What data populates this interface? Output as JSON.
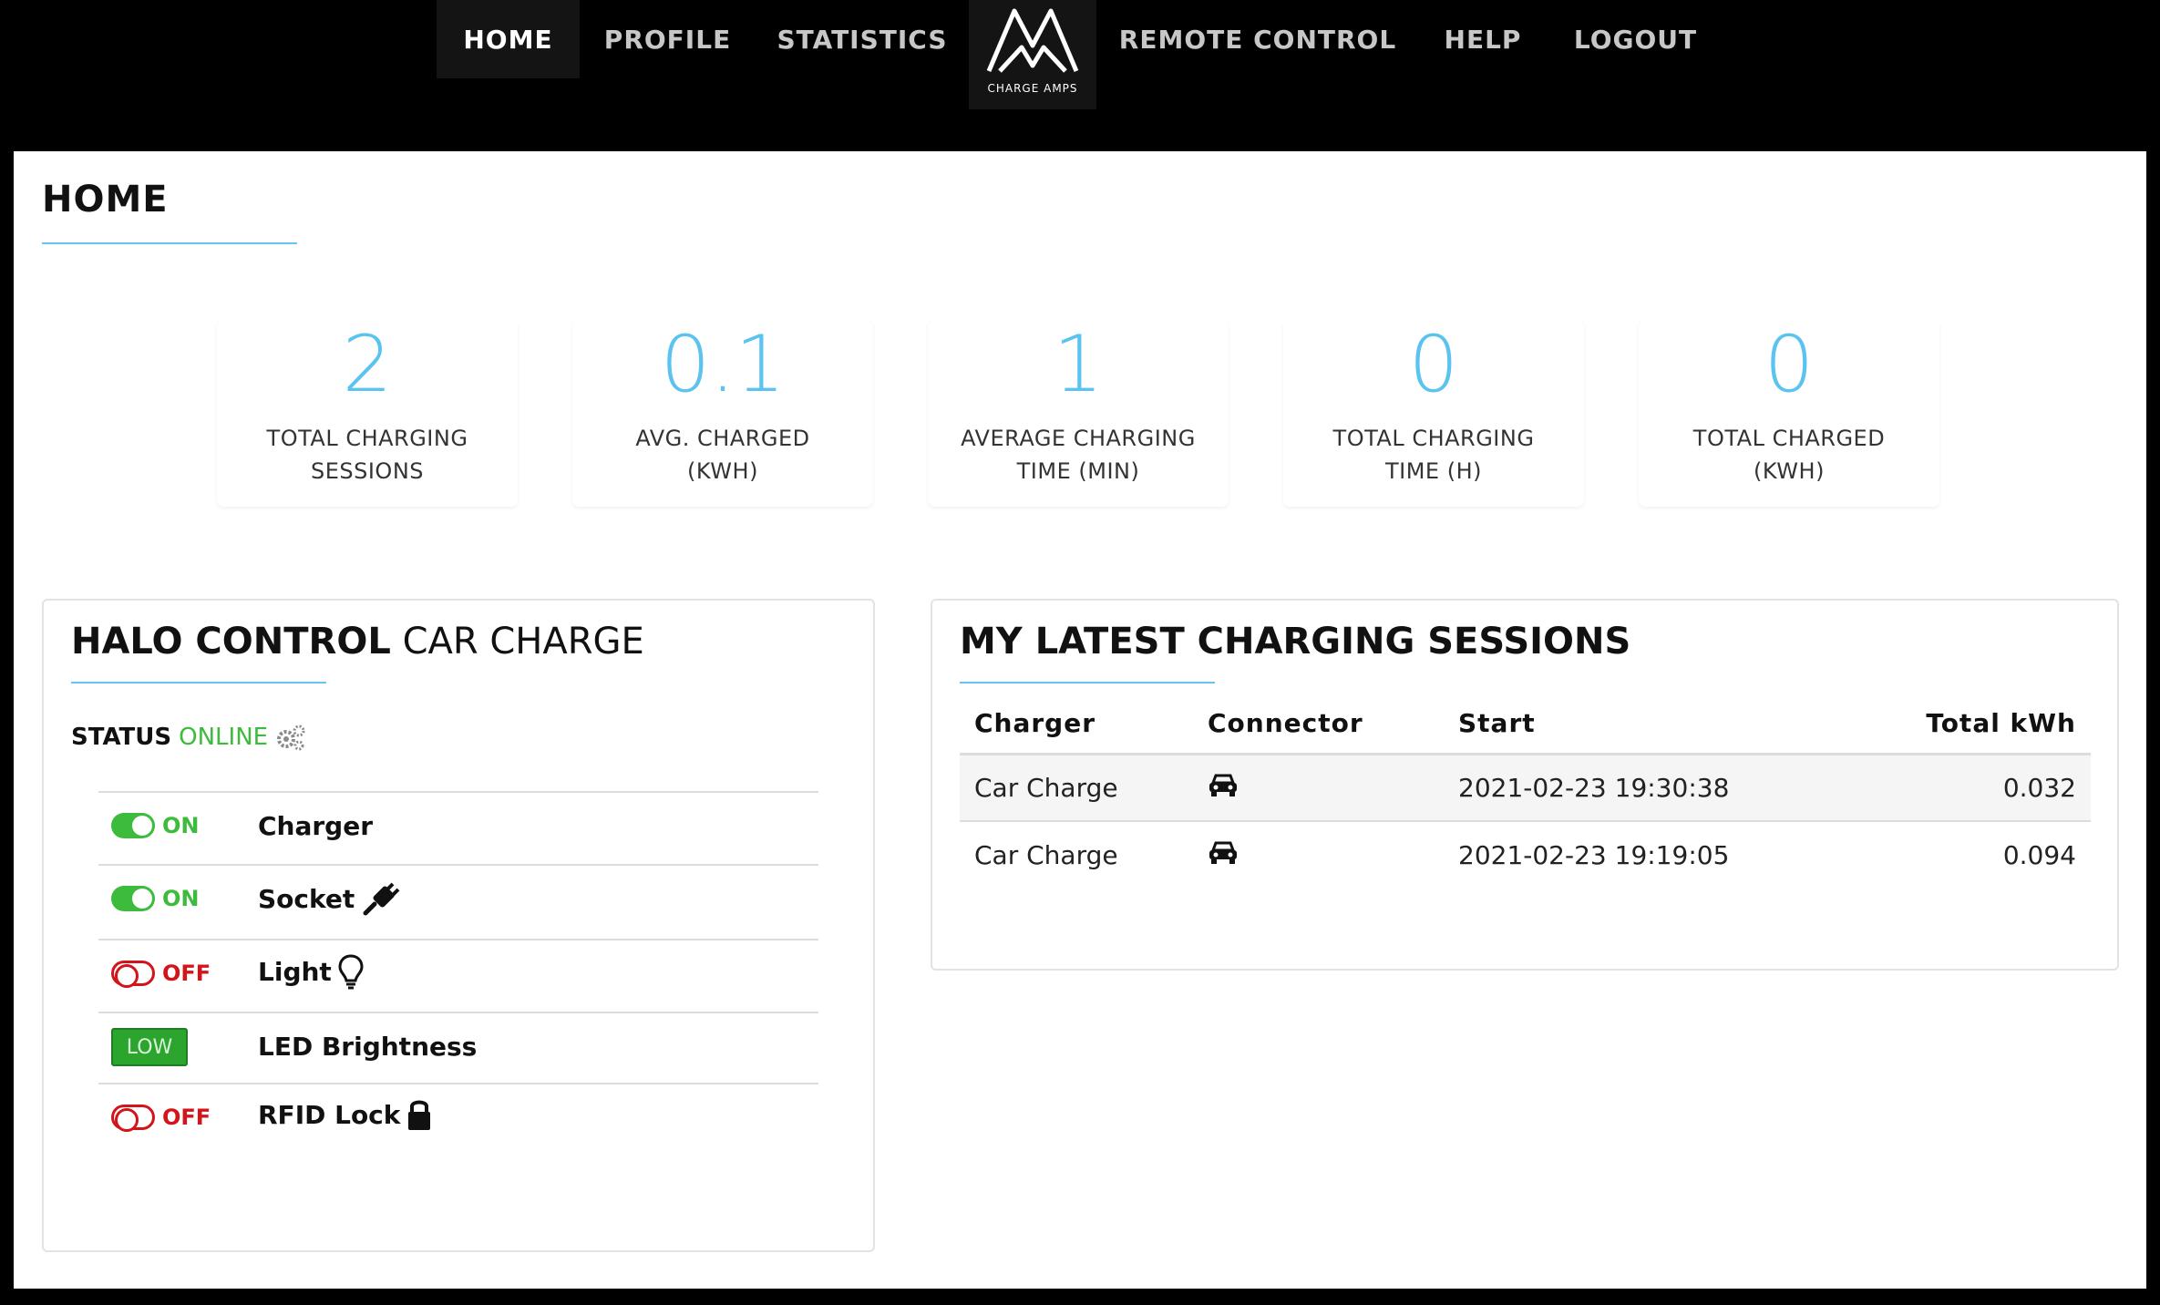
{
  "nav": {
    "home": "HOME",
    "profile": "PROFILE",
    "statistics": "STATISTICS",
    "logo_text": "CHARGE AMPS",
    "remote_control": "REMOTE CONTROL",
    "help": "HELP",
    "logout": "LOGOUT"
  },
  "page": {
    "title": "HOME"
  },
  "stats": [
    {
      "value": "2",
      "label_line1": "TOTAL CHARGING",
      "label_line2": "SESSIONS"
    },
    {
      "value": "0.1",
      "label_line1": "AVG. CHARGED",
      "label_line2": "(KWH)"
    },
    {
      "value": "1",
      "label_line1": "AVERAGE CHARGING",
      "label_line2": "TIME (MIN)"
    },
    {
      "value": "0",
      "label_line1": "TOTAL CHARGING",
      "label_line2": "TIME (H)"
    },
    {
      "value": "0",
      "label_line1": "TOTAL CHARGED",
      "label_line2": "(KWH)"
    }
  ],
  "halo": {
    "title_bold": "HALO CONTROL",
    "title_light": "CAR CHARGE",
    "status_label": "STATUS",
    "status_value": "ONLINE",
    "controls": [
      {
        "state": "ON",
        "name": "Charger",
        "icon": ""
      },
      {
        "state": "ON",
        "name": "Socket",
        "icon": "plug-icon"
      },
      {
        "state": "OFF",
        "name": "Light",
        "icon": "lightbulb-icon"
      },
      {
        "state": "LOW",
        "name": "LED Brightness",
        "icon": ""
      },
      {
        "state": "OFF",
        "name": "RFID Lock",
        "icon": "lock-icon"
      }
    ]
  },
  "sessions": {
    "title": "MY LATEST CHARGING SESSIONS",
    "headers": {
      "charger": "Charger",
      "connector": "Connector",
      "start": "Start",
      "total": "Total kWh"
    },
    "rows": [
      {
        "charger": "Car Charge",
        "connector": "car-icon",
        "start": "2021-02-23 19:30:38",
        "total": "0.032"
      },
      {
        "charger": "Car Charge",
        "connector": "car-icon",
        "start": "2021-02-23 19:19:05",
        "total": "0.094"
      }
    ]
  },
  "colors": {
    "accent": "#5bc3f0",
    "on": "#3dbb3d",
    "off": "#d3141b"
  }
}
